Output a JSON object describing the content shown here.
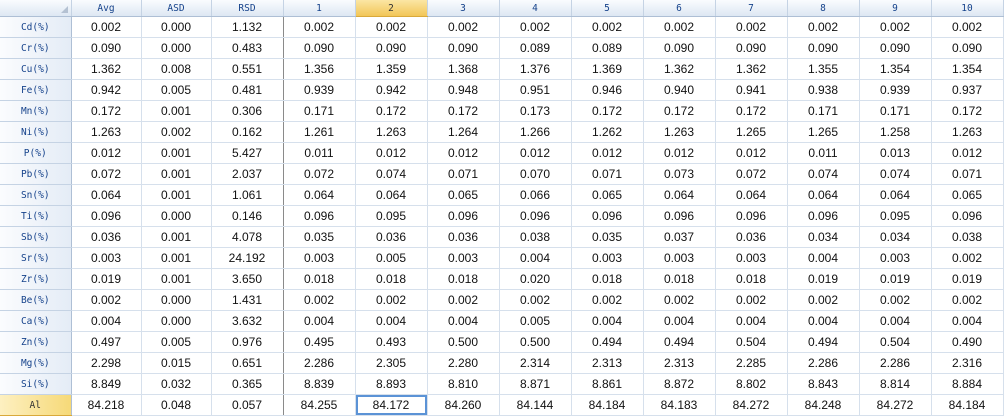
{
  "columns": [
    "Avg",
    "ASD",
    "RSD",
    "1",
    "2",
    "3",
    "4",
    "5",
    "6",
    "7",
    "8",
    "9",
    "10"
  ],
  "selected_column": "2",
  "rows": [
    {
      "label": "Cd(%)",
      "cells": [
        "0.002",
        "0.000",
        "1.132",
        "0.002",
        "0.002",
        "0.002",
        "0.002",
        "0.002",
        "0.002",
        "0.002",
        "0.002",
        "0.002",
        "0.002"
      ]
    },
    {
      "label": "Cr(%)",
      "cells": [
        "0.090",
        "0.000",
        "0.483",
        "0.090",
        "0.090",
        "0.090",
        "0.089",
        "0.089",
        "0.090",
        "0.090",
        "0.090",
        "0.090",
        "0.090"
      ]
    },
    {
      "label": "Cu(%)",
      "cells": [
        "1.362",
        "0.008",
        "0.551",
        "1.356",
        "1.359",
        "1.368",
        "1.376",
        "1.369",
        "1.362",
        "1.362",
        "1.355",
        "1.354",
        "1.354"
      ]
    },
    {
      "label": "Fe(%)",
      "cells": [
        "0.942",
        "0.005",
        "0.481",
        "0.939",
        "0.942",
        "0.948",
        "0.951",
        "0.946",
        "0.940",
        "0.941",
        "0.938",
        "0.939",
        "0.937"
      ]
    },
    {
      "label": "Mn(%)",
      "cells": [
        "0.172",
        "0.001",
        "0.306",
        "0.171",
        "0.172",
        "0.172",
        "0.173",
        "0.172",
        "0.172",
        "0.172",
        "0.171",
        "0.171",
        "0.172"
      ]
    },
    {
      "label": "Ni(%)",
      "cells": [
        "1.263",
        "0.002",
        "0.162",
        "1.261",
        "1.263",
        "1.264",
        "1.266",
        "1.262",
        "1.263",
        "1.265",
        "1.265",
        "1.258",
        "1.263"
      ]
    },
    {
      "label": "P(%)",
      "cells": [
        "0.012",
        "0.001",
        "5.427",
        "0.011",
        "0.012",
        "0.012",
        "0.012",
        "0.012",
        "0.012",
        "0.012",
        "0.011",
        "0.013",
        "0.012"
      ]
    },
    {
      "label": "Pb(%)",
      "cells": [
        "0.072",
        "0.001",
        "2.037",
        "0.072",
        "0.074",
        "0.071",
        "0.070",
        "0.071",
        "0.073",
        "0.072",
        "0.074",
        "0.074",
        "0.071"
      ]
    },
    {
      "label": "Sn(%)",
      "cells": [
        "0.064",
        "0.001",
        "1.061",
        "0.064",
        "0.064",
        "0.065",
        "0.066",
        "0.065",
        "0.064",
        "0.064",
        "0.064",
        "0.064",
        "0.065"
      ]
    },
    {
      "label": "Ti(%)",
      "cells": [
        "0.096",
        "0.000",
        "0.146",
        "0.096",
        "0.095",
        "0.096",
        "0.096",
        "0.096",
        "0.096",
        "0.096",
        "0.096",
        "0.095",
        "0.096"
      ]
    },
    {
      "label": "Sb(%)",
      "cells": [
        "0.036",
        "0.001",
        "4.078",
        "0.035",
        "0.036",
        "0.036",
        "0.038",
        "0.035",
        "0.037",
        "0.036",
        "0.034",
        "0.034",
        "0.038"
      ]
    },
    {
      "label": "Sr(%)",
      "cells": [
        "0.003",
        "0.001",
        "24.192",
        "0.003",
        "0.005",
        "0.003",
        "0.004",
        "0.003",
        "0.003",
        "0.003",
        "0.004",
        "0.003",
        "0.002"
      ]
    },
    {
      "label": "Zr(%)",
      "cells": [
        "0.019",
        "0.001",
        "3.650",
        "0.018",
        "0.018",
        "0.018",
        "0.020",
        "0.018",
        "0.018",
        "0.018",
        "0.019",
        "0.019",
        "0.019"
      ]
    },
    {
      "label": "Be(%)",
      "cells": [
        "0.002",
        "0.000",
        "1.431",
        "0.002",
        "0.002",
        "0.002",
        "0.002",
        "0.002",
        "0.002",
        "0.002",
        "0.002",
        "0.002",
        "0.002"
      ]
    },
    {
      "label": "Ca(%)",
      "cells": [
        "0.004",
        "0.000",
        "3.632",
        "0.004",
        "0.004",
        "0.004",
        "0.005",
        "0.004",
        "0.004",
        "0.004",
        "0.004",
        "0.004",
        "0.004"
      ]
    },
    {
      "label": "Zn(%)",
      "cells": [
        "0.497",
        "0.005",
        "0.976",
        "0.495",
        "0.493",
        "0.500",
        "0.500",
        "0.494",
        "0.494",
        "0.504",
        "0.494",
        "0.504",
        "0.490"
      ]
    },
    {
      "label": "Mg(%)",
      "cells": [
        "2.298",
        "0.015",
        "0.651",
        "2.286",
        "2.305",
        "2.280",
        "2.314",
        "2.313",
        "2.313",
        "2.285",
        "2.286",
        "2.286",
        "2.316"
      ]
    },
    {
      "label": "Si(%)",
      "cells": [
        "8.849",
        "0.032",
        "0.365",
        "8.839",
        "8.893",
        "8.810",
        "8.871",
        "8.861",
        "8.872",
        "8.802",
        "8.843",
        "8.814",
        "8.884"
      ]
    },
    {
      "label": "Al",
      "cells": [
        "84.218",
        "0.048",
        "0.057",
        "84.255",
        "84.172",
        "84.260",
        "84.144",
        "84.184",
        "84.183",
        "84.272",
        "84.248",
        "84.272",
        "84.184"
      ]
    }
  ],
  "selected_row": "Al",
  "active_cell": {
    "row": "Al",
    "column": "2"
  }
}
